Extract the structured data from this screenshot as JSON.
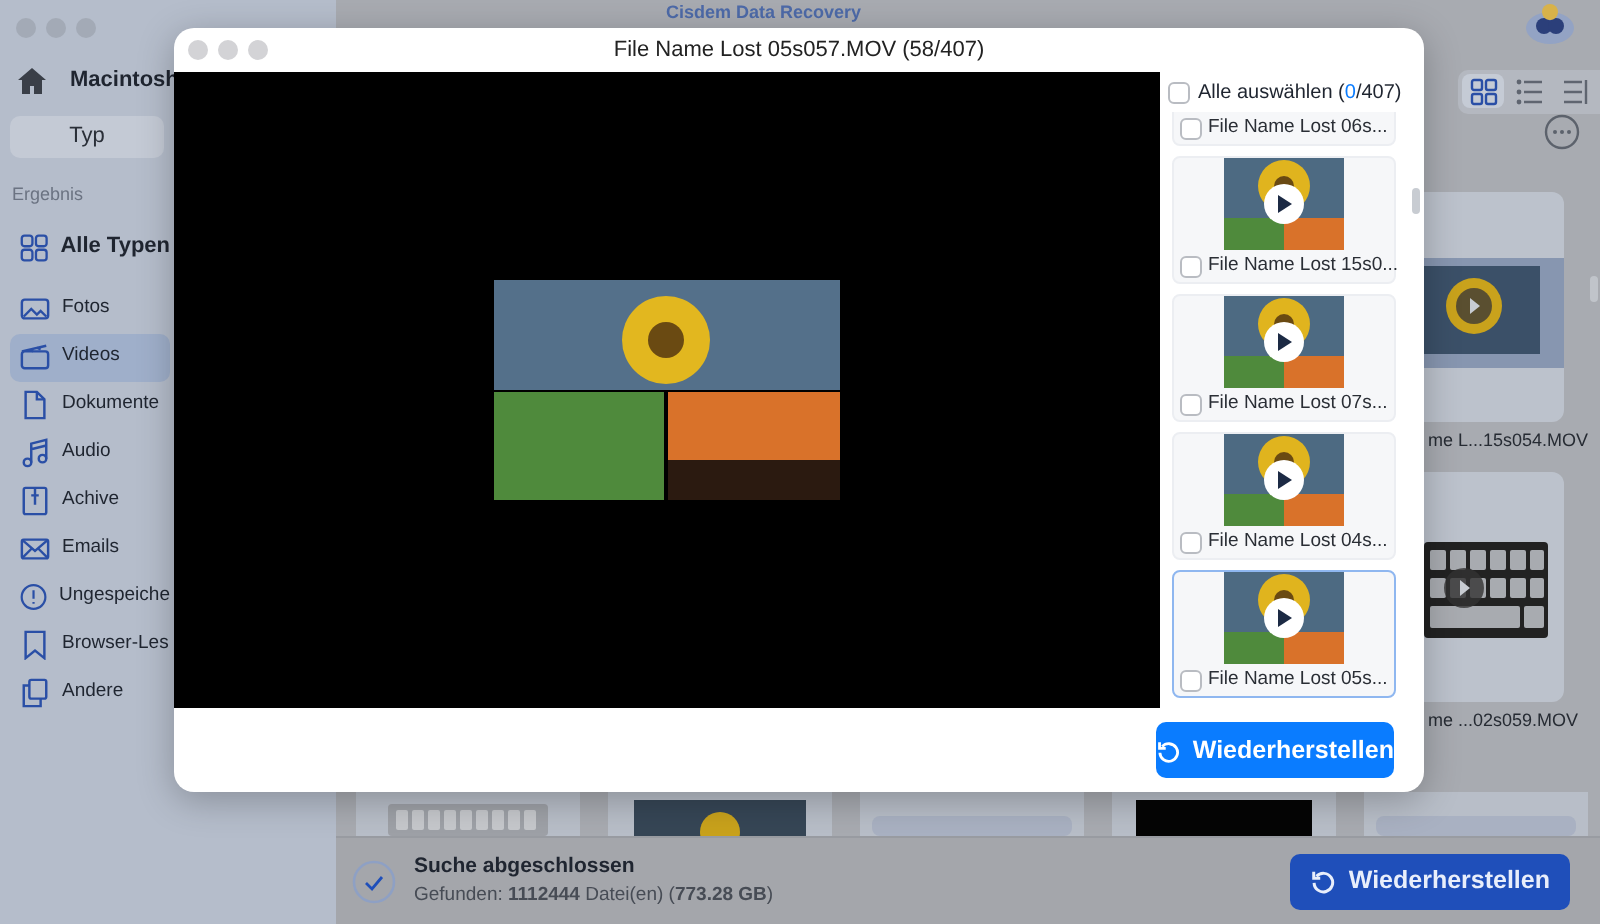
{
  "app": {
    "title": "Cisdem Data Recovery"
  },
  "sidebar": {
    "drive": "Macintosh",
    "tab": {
      "label": "Typ",
      "selected": true
    },
    "section": "Ergebnis",
    "items": [
      {
        "label": "Alle Typen",
        "kind": "all",
        "selected": false
      },
      {
        "label": "Fotos",
        "kind": "photo",
        "selected": false
      },
      {
        "label": "Videos",
        "kind": "video",
        "selected": true
      },
      {
        "label": "Dokumente",
        "kind": "document",
        "selected": false
      },
      {
        "label": "Audio",
        "kind": "audio",
        "selected": false
      },
      {
        "label": "Achive",
        "kind": "archive",
        "selected": false
      },
      {
        "label": "Emails",
        "kind": "email",
        "selected": false
      },
      {
        "label": "Ungespeiche",
        "kind": "unsaved",
        "selected": false
      },
      {
        "label": "Browser-Les",
        "kind": "bookmark",
        "selected": false
      },
      {
        "label": "Andere",
        "kind": "other",
        "selected": false
      }
    ]
  },
  "toolbar": {
    "views": [
      {
        "kind": "grid",
        "selected": true
      },
      {
        "kind": "list",
        "selected": false
      },
      {
        "kind": "columns",
        "selected": false
      }
    ]
  },
  "background_files": [
    {
      "name": "me L...15s054.MOV",
      "kind": "sunflower"
    },
    {
      "name": "me ...02s059.MOV",
      "kind": "keyboard"
    }
  ],
  "status_bar": {
    "title": "Suche abgeschlossen",
    "summary": "Gefunden: **1112444** Datei(en) (**773.28 GB**)",
    "button": "Wiederherstellen"
  },
  "preview": {
    "title": "File Name Lost 05s057.MOV (58/407)",
    "select_all": {
      "label": "Alle auswählen",
      "checked": false,
      "count_prefix": "(",
      "count_selected": "0",
      "count_suffix": "/407)"
    },
    "items": [
      {
        "name": "File Name Lost 06s...",
        "checked": false,
        "selected": false
      },
      {
        "name": "File Name Lost 15s0...",
        "checked": false,
        "selected": false
      },
      {
        "name": "File Name Lost 07s...",
        "checked": false,
        "selected": false
      },
      {
        "name": "File Name Lost 04s...",
        "checked": false,
        "selected": false
      },
      {
        "name": "File Name Lost 05s...",
        "checked": false,
        "selected": true
      }
    ],
    "button": "Wiederherstellen"
  }
}
